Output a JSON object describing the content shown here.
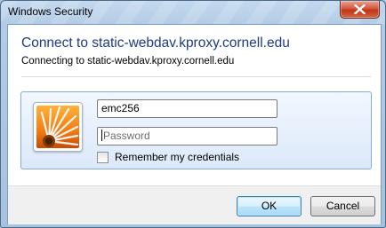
{
  "window": {
    "title": "Windows Security"
  },
  "dialog": {
    "heading": "Connect to static-webdav.kproxy.cornell.edu",
    "subheading": "Connecting to static-webdav.kproxy.cornell.edu"
  },
  "credentials": {
    "username_value": "emc256",
    "password_placeholder": "Password",
    "remember_label": "Remember my credentials",
    "remember_checked": false
  },
  "buttons": {
    "ok_label": "OK",
    "cancel_label": "Cancel"
  }
}
